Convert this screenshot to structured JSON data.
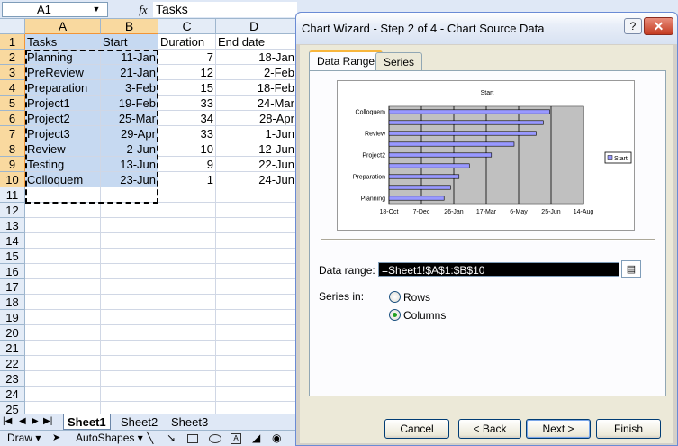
{
  "formula_bar": {
    "name_box": "A1",
    "name_dropdown": "▼",
    "fx": "fx",
    "formula": "Tasks"
  },
  "columns": [
    "A",
    "B",
    "C",
    "D"
  ],
  "rows": [
    "1",
    "2",
    "3",
    "4",
    "5",
    "6",
    "7",
    "8",
    "9",
    "10",
    "11",
    "12",
    "13",
    "14",
    "15",
    "16",
    "17",
    "18",
    "19",
    "20",
    "21",
    "22",
    "23",
    "24",
    "25"
  ],
  "sheet": [
    [
      "Tasks",
      "Start",
      "Duration",
      "End date"
    ],
    [
      "Planning",
      "11-Jan",
      "7",
      "18-Jan"
    ],
    [
      "PreReview",
      "21-Jan",
      "12",
      "2-Feb"
    ],
    [
      "Preparation",
      "3-Feb",
      "15",
      "18-Feb"
    ],
    [
      "Project1",
      "19-Feb",
      "33",
      "24-Mar"
    ],
    [
      "Project2",
      "25-Mar",
      "34",
      "28-Apr"
    ],
    [
      "Project3",
      "29-Apr",
      "33",
      "1-Jun"
    ],
    [
      "Review",
      "2-Jun",
      "10",
      "12-Jun"
    ],
    [
      "Testing",
      "13-Jun",
      "9",
      "22-Jun"
    ],
    [
      "Colloquem",
      "23-Jun",
      "1",
      "24-Jun"
    ]
  ],
  "sheet_tabs": {
    "nav": [
      "|◀",
      "◀",
      "▶",
      "▶|"
    ],
    "tabs": [
      "Sheet1",
      "Sheet2",
      "Sheet3"
    ],
    "active": "Sheet1"
  },
  "draw_toolbar": {
    "draw": "Draw ▾",
    "autoshapes": "AutoShapes ▾"
  },
  "dialog": {
    "title": "Chart Wizard - Step 2 of 4 - Chart Source Data",
    "help": "?",
    "close": "✕",
    "tabs": [
      "Data Range",
      "Series"
    ],
    "active_tab": "Data Range",
    "data_range_label": "Data range:",
    "data_range_value": "=Sheet1!$A$1:$B$10",
    "series_in_label": "Series in:",
    "series_in_options": [
      "Rows",
      "Columns"
    ],
    "series_in_selected": "Columns",
    "buttons": {
      "cancel": "Cancel",
      "back": "< Back",
      "next": "Next >",
      "finish": "Finish"
    }
  },
  "chart_data": {
    "type": "bar",
    "orientation": "horizontal",
    "title": "Start",
    "categories": [
      "Planning",
      "PreReview",
      "Preparation",
      "Project1",
      "Project2",
      "Project3",
      "Review",
      "Testing",
      "Colloquem"
    ],
    "category_tick_labels": [
      "Planning",
      "Preparation",
      "Project2",
      "Review",
      "Colloquem"
    ],
    "series": [
      {
        "name": "Start",
        "values": [
          "11-Jan",
          "21-Jan",
          "3-Feb",
          "19-Feb",
          "25-Mar",
          "29-Apr",
          "2-Jun",
          "13-Jun",
          "23-Jun"
        ]
      }
    ],
    "x_tick_labels": [
      "18-Oct",
      "7-Dec",
      "26-Jan",
      "17-Mar",
      "6-May",
      "25-Jun",
      "14-Aug"
    ],
    "xlim": [
      "18-Oct",
      "14-Aug"
    ],
    "grid": true,
    "legend": "right",
    "bar_color": "#9999ff",
    "plot_background": "#c0c0c0"
  }
}
